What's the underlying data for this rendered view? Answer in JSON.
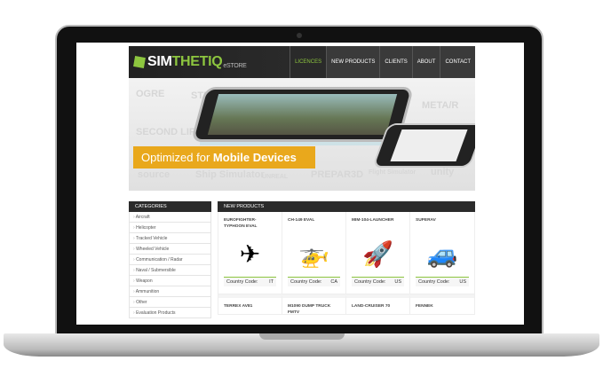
{
  "header": {
    "logo": {
      "a": "SIM",
      "b": "THETIQ",
      "c": "eSTORE"
    },
    "nav": [
      "LICENCES",
      "NEW PRODUCTS",
      "CLIENTS",
      "ABOUT",
      "CONTACT"
    ],
    "active": "LICENCES"
  },
  "banner": {
    "headline_plain": "Optimized for ",
    "headline_bold": "Mobile Devices",
    "subtitle": "Ideal for Serious Gaming Platforms",
    "logos": [
      "OGRE",
      "STEEL",
      "META/R",
      "SECOND LIFE",
      "source",
      "Ship Simulator",
      "UNREAL",
      "PREPAR3D",
      "Flight Simulator",
      "unity"
    ]
  },
  "sidebar": {
    "title": "CATEGORIES",
    "items": [
      "Aircraft",
      "Helicopter",
      "Tracked Vehicle",
      "Wheeled Vehicle",
      "Communication / Radar",
      "Naval / Submersible",
      "Weapon",
      "Ammunition",
      "Other",
      "Evaluation Products"
    ]
  },
  "products": {
    "title": "NEW PRODUCTS",
    "country_label": "Country Code:",
    "row1": [
      {
        "name": "EUROFIGHTER-TYPHOON EVAL",
        "code": "IT",
        "icon": "✈"
      },
      {
        "name": "CH-149 EVAL",
        "code": "CA",
        "icon": "🚁"
      },
      {
        "name": "MIM-104-LAUNCHER",
        "code": "US",
        "icon": "🚀"
      },
      {
        "name": "SUPERAV",
        "code": "US",
        "icon": "🚙"
      }
    ],
    "row2": [
      {
        "name": "TERREX AV81"
      },
      {
        "name": "M1090 DUMP TRUCK FMTV"
      },
      {
        "name": "LAND-CRUISER 70"
      },
      {
        "name": "FENNEK"
      }
    ]
  },
  "colors": {
    "accent": "#8dc63f",
    "banner": "#e9a81c"
  }
}
